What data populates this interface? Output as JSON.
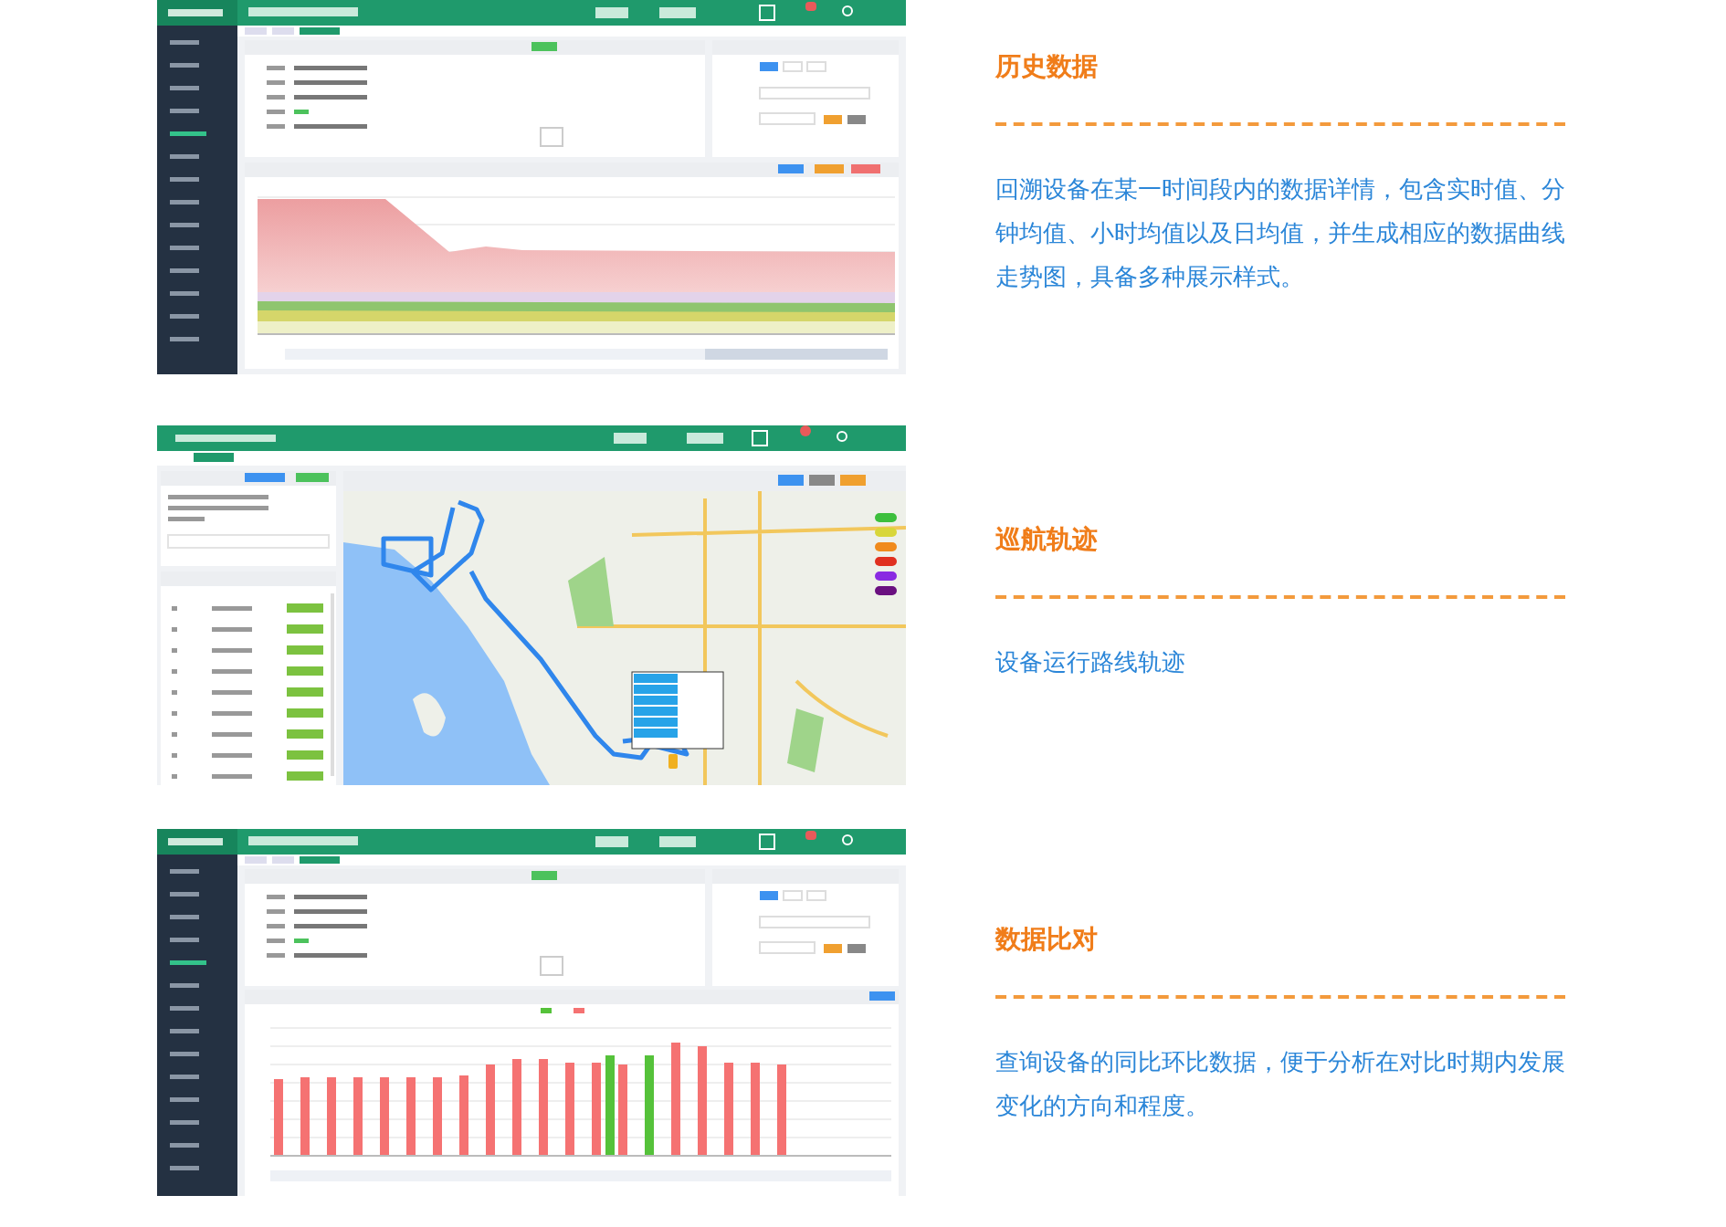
{
  "features": [
    {
      "title": "历史数据",
      "description": "回溯设备在某一时间段内的数据详情，包含实时值、分钟均值、小时均值以及日均值，并生成相应的数据曲线走势图，具备多种展示样式。",
      "screenshot": {
        "kind": "history"
      }
    },
    {
      "title": "巡航轨迹",
      "description": "设备运行路线轨迹",
      "screenshot": {
        "kind": "track"
      }
    },
    {
      "title": "数据比对",
      "description": "查询设备的同比环比数据，便于分析在对比时期内发展变化的方向和程度。",
      "screenshot": {
        "kind": "compare"
      }
    }
  ]
}
